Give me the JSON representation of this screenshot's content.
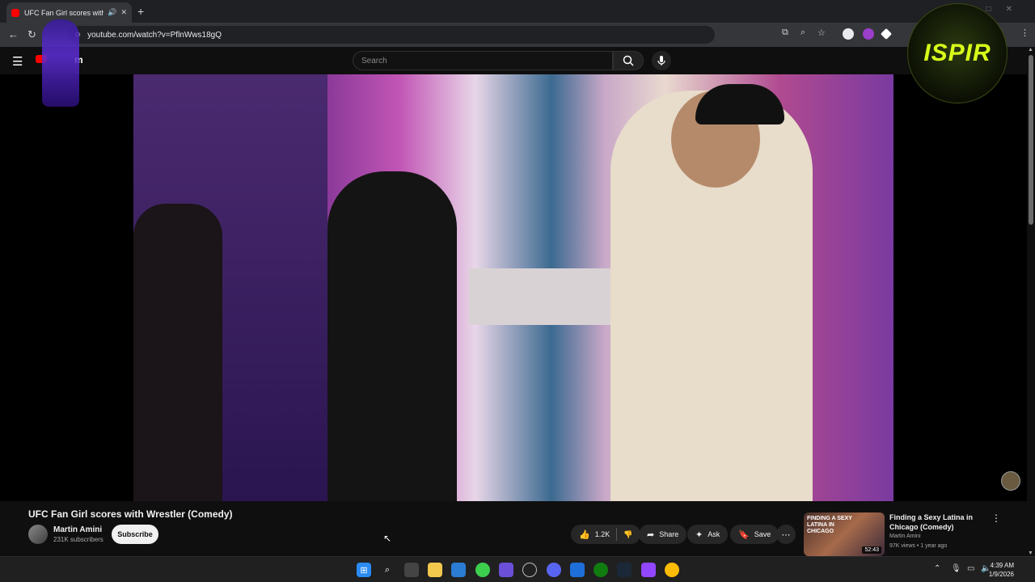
{
  "browser": {
    "tab_title": "UFC Fan Girl scores with W",
    "url": "youtube.com/watch?v=PflnWws18gQ",
    "new_tab": "+",
    "close": "✕"
  },
  "youtube": {
    "logo_text": "m",
    "search_placeholder": "Search"
  },
  "overlay": {
    "logo_text": "ISPIR"
  },
  "video": {
    "title": "UFC Fan Girl scores with Wrestler (Comedy)",
    "channel": "Martin Amini",
    "subscribers": "231K subscribers",
    "subscribe_label": "Subscribe",
    "likes": "1.2K",
    "share_label": "Share",
    "ask_label": "Ask",
    "save_label": "Save"
  },
  "related": {
    "thumb_text": "FINDING A SEXY LATINA IN CHICAGO",
    "duration": "52:43",
    "title": "Finding a Sexy Latina in Chicago (Comedy)",
    "channel": "Martin Amini",
    "meta": "97K views • 1 year ago"
  },
  "taskbar": {
    "time": "4:39 AM",
    "date": "1/9/2026"
  },
  "colors": {
    "brand_red": "#ff0000",
    "page_bg": "#0f0f0f",
    "pill_bg": "#272727"
  }
}
